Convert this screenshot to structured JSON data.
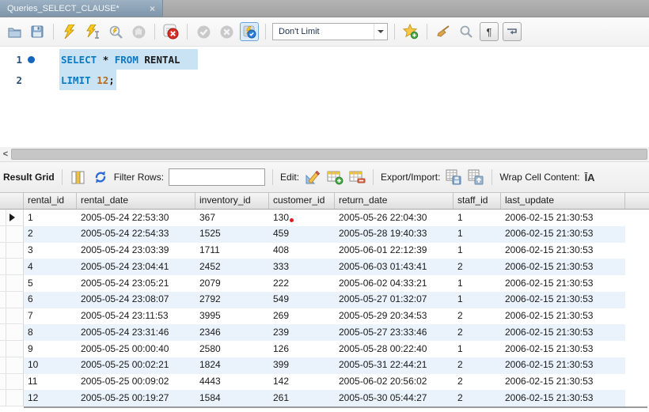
{
  "tab": {
    "title": "Queries_SELECT_CLAUSE*",
    "close_glyph": "×"
  },
  "toolbar": {
    "icons": [
      "open-script-icon",
      "save-script-icon",
      "execute-icon",
      "execute-current-icon",
      "explain-icon",
      "stop-icon",
      "toggle-stop-on-error-icon",
      "commit-icon",
      "rollback-icon",
      "toggle-autocommit-icon",
      "new-snippet-icon",
      "beautify-icon",
      "find-icon",
      "show-invisibles-icon",
      "toggle-wrapping-icon"
    ],
    "limit_dropdown_value": "Don't Limit",
    "show_invisibles_glyph": "¶"
  },
  "editor": {
    "lines": [
      {
        "number": "1",
        "has_breakpoint_dot": true,
        "highlighted": true,
        "trail": true,
        "tokens": [
          {
            "text": "SELECT",
            "type": "keyword"
          },
          {
            "text": " ",
            "type": "plain"
          },
          {
            "text": "*",
            "type": "operator"
          },
          {
            "text": " ",
            "type": "plain"
          },
          {
            "text": "FROM",
            "type": "keyword"
          },
          {
            "text": " ",
            "type": "plain"
          },
          {
            "text": "RENTAL",
            "type": "plain"
          }
        ]
      },
      {
        "number": "2",
        "has_breakpoint_dot": false,
        "highlighted": true,
        "trail": false,
        "tokens": [
          {
            "text": "LIMIT",
            "type": "keyword"
          },
          {
            "text": " ",
            "type": "plain"
          },
          {
            "text": "12",
            "type": "number"
          },
          {
            "text": ";",
            "type": "plain"
          }
        ]
      }
    ]
  },
  "hscroll": {
    "collapse_label": "<"
  },
  "grid_toolbar": {
    "result_grid_label": "Result Grid",
    "filter_rows_label": "Filter Rows:",
    "filter_value": "",
    "edit_label": "Edit:",
    "export_import_label": "Export/Import:",
    "wrap_cell_label": "Wrap Cell Content:",
    "wrap_cell_icon_glyph": "ĪA",
    "icons": [
      "grid-view-icon",
      "refresh-icon",
      "edit-record-icon",
      "insert-row-icon",
      "delete-row-icon",
      "export-recordset-icon",
      "import-records-icon",
      "wrap-cell-icon"
    ]
  },
  "table": {
    "columns": [
      "rental_id",
      "rental_date",
      "inventory_id",
      "customer_id",
      "return_date",
      "staff_id",
      "last_update"
    ],
    "rows": [
      [
        "1",
        "2005-05-24 22:53:30",
        "367",
        "130",
        "2005-05-26 22:04:30",
        "1",
        "2006-02-15 21:30:53"
      ],
      [
        "2",
        "2005-05-24 22:54:33",
        "1525",
        "459",
        "2005-05-28 19:40:33",
        "1",
        "2006-02-15 21:30:53"
      ],
      [
        "3",
        "2005-05-24 23:03:39",
        "1711",
        "408",
        "2005-06-01 22:12:39",
        "1",
        "2006-02-15 21:30:53"
      ],
      [
        "4",
        "2005-05-24 23:04:41",
        "2452",
        "333",
        "2005-06-03 01:43:41",
        "2",
        "2006-02-15 21:30:53"
      ],
      [
        "5",
        "2005-05-24 23:05:21",
        "2079",
        "222",
        "2005-06-02 04:33:21",
        "1",
        "2006-02-15 21:30:53"
      ],
      [
        "6",
        "2005-05-24 23:08:07",
        "2792",
        "549",
        "2005-05-27 01:32:07",
        "1",
        "2006-02-15 21:30:53"
      ],
      [
        "7",
        "2005-05-24 23:11:53",
        "3995",
        "269",
        "2005-05-29 20:34:53",
        "2",
        "2006-02-15 21:30:53"
      ],
      [
        "8",
        "2005-05-24 23:31:46",
        "2346",
        "239",
        "2005-05-27 23:33:46",
        "2",
        "2006-02-15 21:30:53"
      ],
      [
        "9",
        "2005-05-25 00:00:40",
        "2580",
        "126",
        "2005-05-28 00:22:40",
        "1",
        "2006-02-15 21:30:53"
      ],
      [
        "10",
        "2005-05-25 00:02:21",
        "1824",
        "399",
        "2005-05-31 22:44:21",
        "2",
        "2006-02-15 21:30:53"
      ],
      [
        "11",
        "2005-05-25 00:09:02",
        "4443",
        "142",
        "2005-06-02 20:56:02",
        "2",
        "2006-02-15 21:30:53"
      ],
      [
        "12",
        "2005-05-25 00:19:27",
        "1584",
        "261",
        "2005-05-30 05:44:27",
        "2",
        "2006-02-15 21:30:53"
      ]
    ],
    "active_row_index": 0,
    "red_marker": {
      "row": 0,
      "col": 3
    }
  },
  "colors": {
    "keyword": "#0a7ac2",
    "number": "#b66a22",
    "line_number": "#2d4f77",
    "breakpoint_dot": "#1464c0",
    "statement_highlight": "#c9e3f5",
    "alt_row": "#eaf2fb",
    "tab_active": "#8da6ba"
  }
}
